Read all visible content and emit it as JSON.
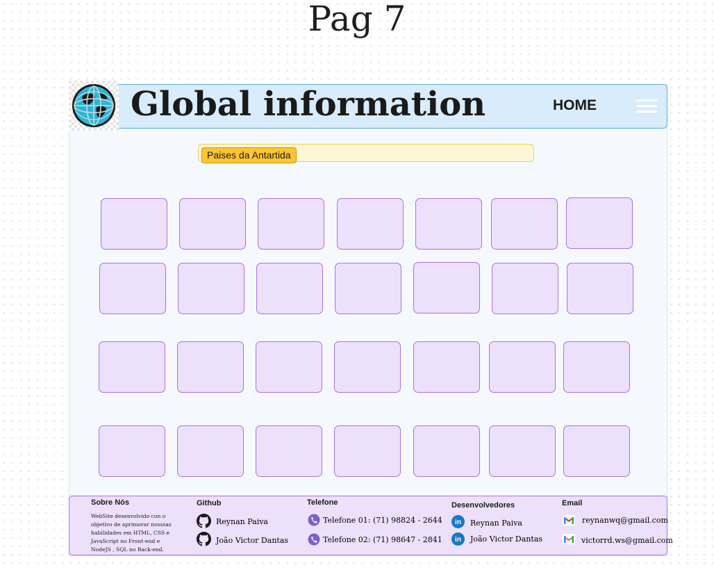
{
  "page_label": "Pag 7",
  "header": {
    "title": "Global information",
    "nav_home": "HOME",
    "logo_icon": "globe-icon",
    "menu_icon": "hamburger-menu-icon"
  },
  "search": {
    "chip_label": "Paises da Antartida"
  },
  "grid": {
    "rows": 4,
    "columns": 7
  },
  "footer": {
    "about": {
      "heading": "Sobre Nós",
      "text": "WebSite desenvolvido con o objetivo de aprimorar nosssas habilidades em HTML, CSS e JavaScript no Front-end e NodeJS , SQL no Back-end."
    },
    "github": {
      "heading": "Github",
      "items": [
        "Reynan Paiva",
        "João Victor Dantas"
      ],
      "icon": "github-icon"
    },
    "phone": {
      "heading": "Telefone",
      "items": [
        "Telefone 01: (71) 98824 - 2644",
        "Telefone 02: (71) 98647 - 2841"
      ],
      "icon": "viber-phone-icon"
    },
    "devs": {
      "heading": "Desenvolvedores",
      "items": [
        "Reynan Paiva",
        "João Victor Dantas"
      ],
      "icon": "linkedin-icon"
    },
    "email": {
      "heading": "Email",
      "items": [
        "reynanwq@gmail.com",
        "victorrd.ws@gmail.com"
      ],
      "icon": "gmail-icon"
    }
  },
  "colors": {
    "header_bg": "#d8ecfb",
    "card_bg": "#ece0fb",
    "card_border": "#a774e2",
    "chip_bg": "#fdc531",
    "search_bg": "#fff6d6"
  }
}
